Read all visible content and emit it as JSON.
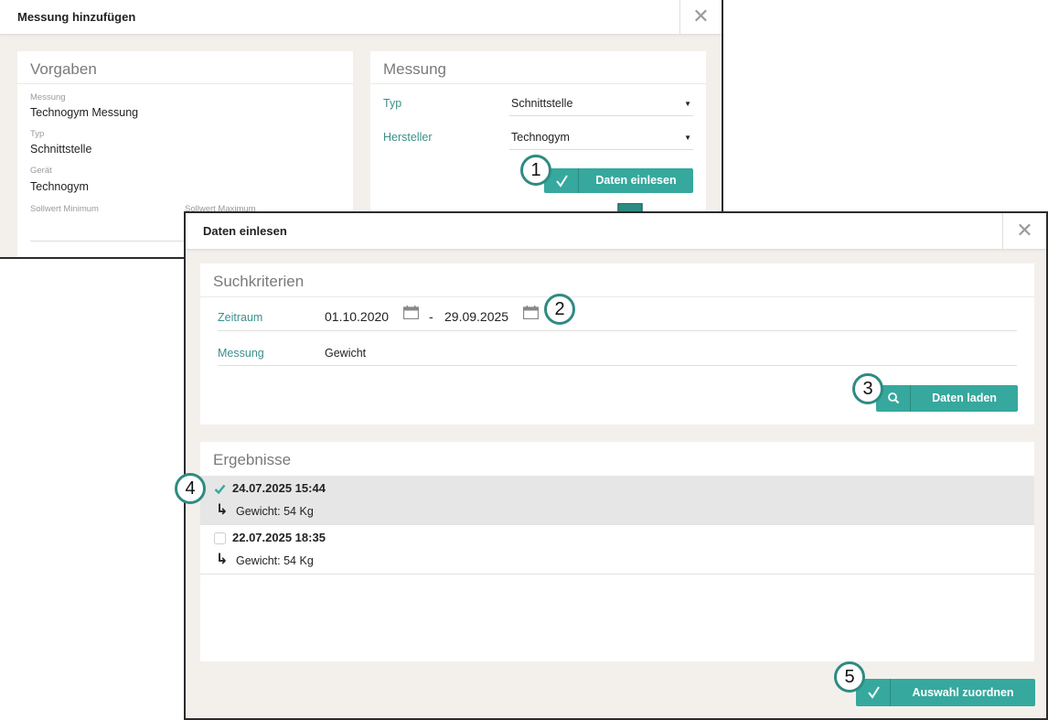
{
  "dialog1": {
    "title": "Messung hinzufügen",
    "close": "✕",
    "vorgaben": {
      "title": "Vorgaben",
      "messung_label": "Messung",
      "messung_value": "Technogym Messung",
      "typ_label": "Typ",
      "typ_value": "Schnittstelle",
      "geraet_label": "Gerät",
      "geraet_value": "Technogym",
      "soll_min_label": "Sollwert Minimum",
      "soll_max_label": "Sollwert Maximum"
    },
    "messung": {
      "title": "Messung",
      "typ_label": "Typ",
      "typ_value": "Schnittstelle",
      "hersteller_label": "Hersteller",
      "hersteller_value": "Technogym",
      "arrow": "▼",
      "button_label": "Daten einlesen",
      "button_icon": "check-icon"
    }
  },
  "dialog2": {
    "title": "Daten einlesen",
    "close": "✕",
    "suchkriterien": {
      "title": "Suchkriterien",
      "zeitraum_label": "Zeitraum",
      "date_from": "01.10.2020",
      "date_sep": "-",
      "date_to": "29.09.2025",
      "messung_label": "Messung",
      "messung_value": "Gewicht",
      "button_label": "Daten laden",
      "button_icon": "search-icon"
    },
    "ergebnisse": {
      "title": "Ergebnisse",
      "results": [
        {
          "datetime": "24.07.2025 15:44",
          "detail": "Gewicht: 54 Kg",
          "checked": true
        },
        {
          "datetime": "22.07.2025 18:35",
          "detail": "Gewicht: 54 Kg",
          "checked": false
        }
      ],
      "arrow_glyph": "↳"
    },
    "assign_button_label": "Auswahl zuordnen",
    "assign_button_icon": "check-icon"
  },
  "badges": [
    "1",
    "2",
    "3",
    "4",
    "5"
  ],
  "colors": {
    "accent": "#36a89e",
    "label_teal": "#3c8f8a",
    "badge_border": "#2e8b82",
    "arrow_fill": "#2e8b82",
    "background": "#f3f0ec"
  }
}
